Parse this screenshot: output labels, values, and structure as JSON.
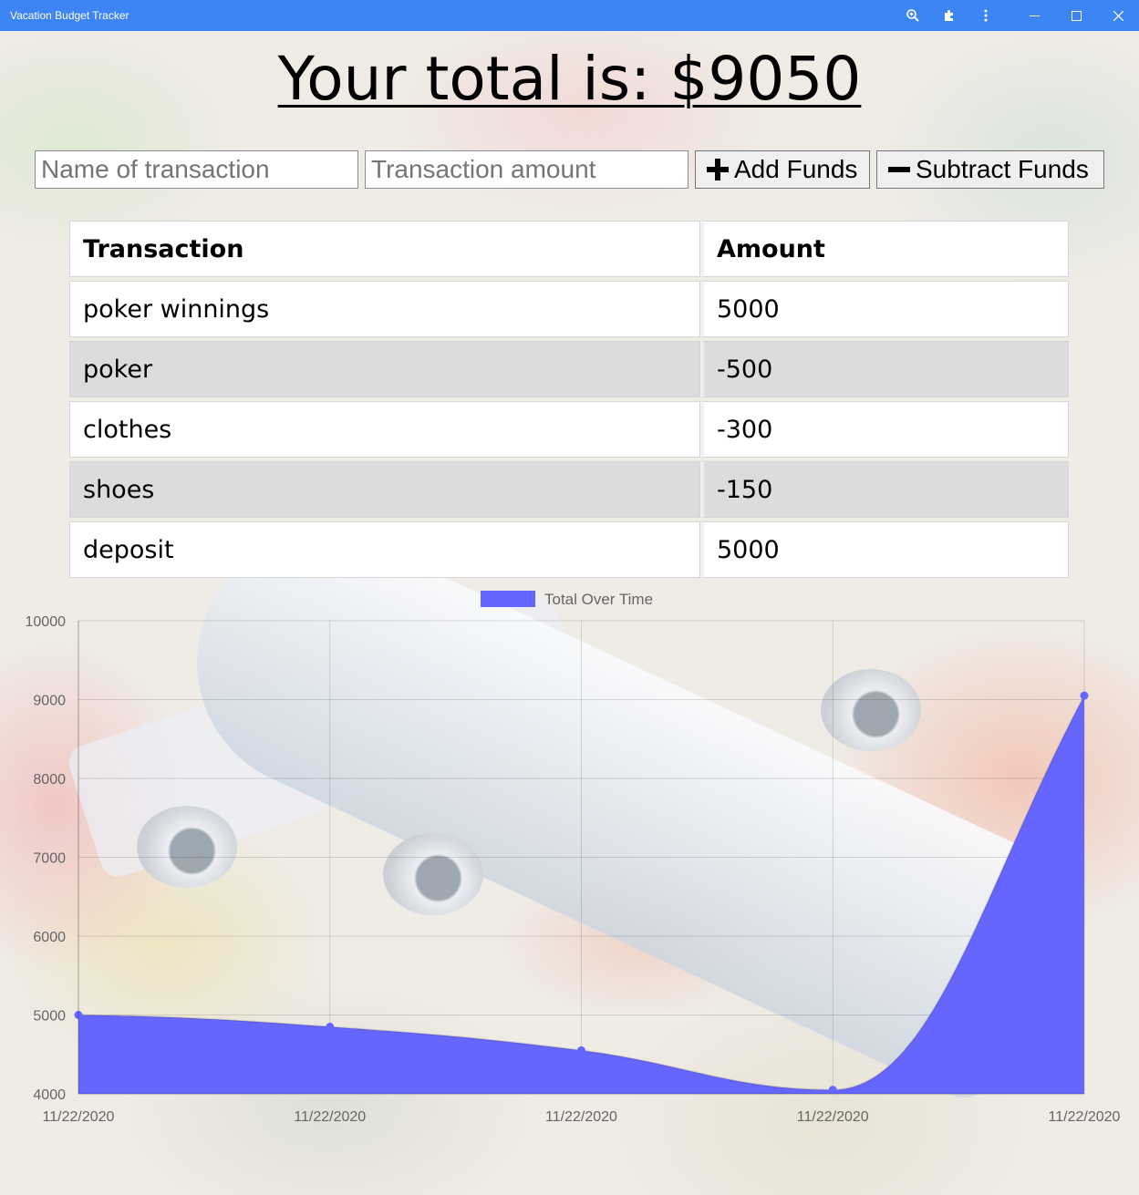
{
  "window": {
    "title": "Vacation Budget Tracker",
    "icons": [
      "zoom-icon",
      "extensions-icon",
      "menu-icon",
      "minimize-icon",
      "maximize-icon",
      "close-icon"
    ]
  },
  "total_label": "Your total is: $9050",
  "form": {
    "name_placeholder": "Name of transaction",
    "amount_placeholder": "Transaction amount",
    "add_label": "Add Funds",
    "subtract_label": "Subtract Funds"
  },
  "table": {
    "headers": [
      "Transaction",
      "Amount"
    ],
    "rows": [
      {
        "name": "poker winnings",
        "amount": "5000"
      },
      {
        "name": "poker",
        "amount": "-500"
      },
      {
        "name": "clothes",
        "amount": "-300"
      },
      {
        "name": "shoes",
        "amount": "-150"
      },
      {
        "name": "deposit",
        "amount": "5000"
      }
    ]
  },
  "colors": {
    "titlebar": "#3d85f5",
    "series_fill": "#6666ff",
    "row_alt": "#dcdcdc"
  },
  "chart_data": {
    "type": "area",
    "x": [
      "11/22/2020",
      "11/22/2020",
      "11/22/2020",
      "11/22/2020",
      "11/22/2020"
    ],
    "series": [
      {
        "name": "Total Over Time",
        "values": [
          5000,
          4850,
          4550,
          4050,
          9050
        ],
        "color": "#6666ff"
      }
    ],
    "ylim": [
      4000,
      10000
    ],
    "yticks": [
      4000,
      5000,
      6000,
      7000,
      8000,
      9000,
      10000
    ],
    "grid": true,
    "legend": "top-center"
  }
}
